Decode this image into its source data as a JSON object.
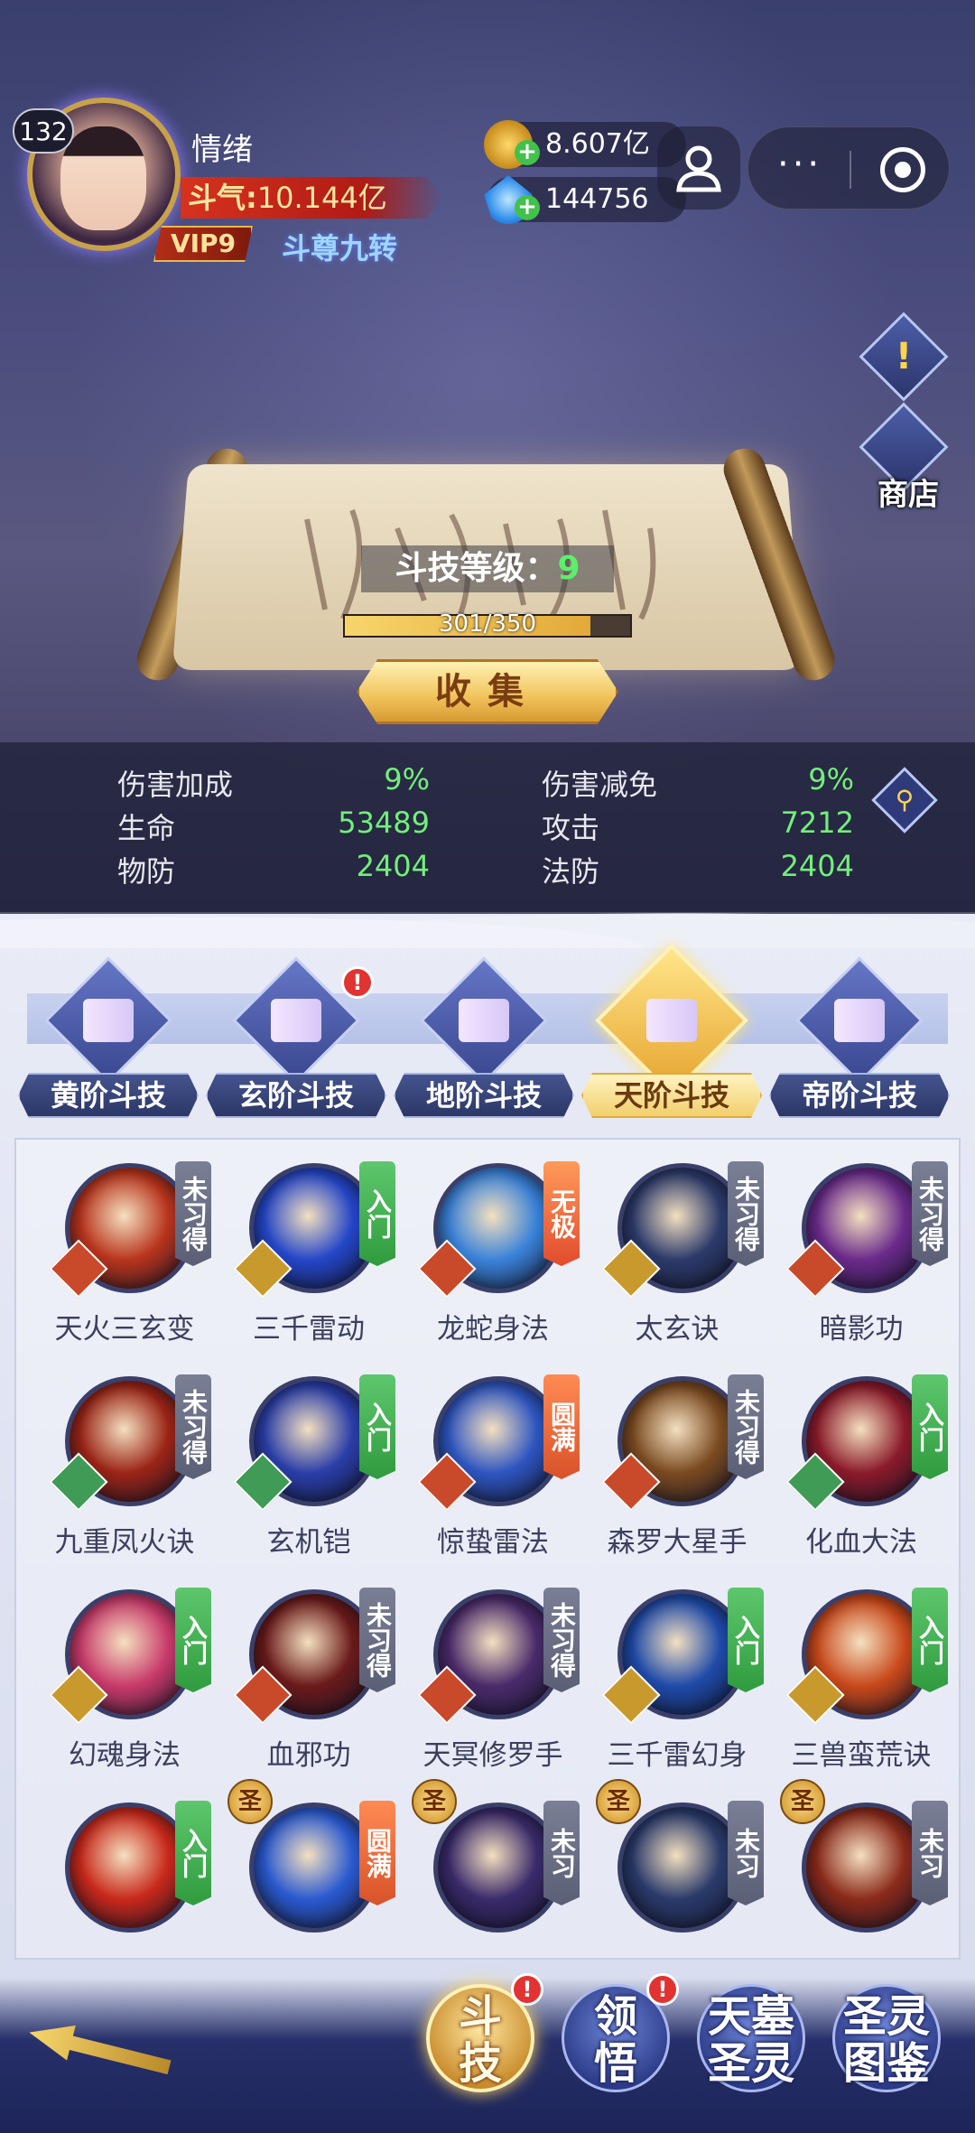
{
  "player": {
    "level": "132",
    "name": "情绪",
    "power_label": "斗气:",
    "power_value": "10.144亿",
    "vip": "VIP9",
    "rank": "斗尊九转"
  },
  "currency": {
    "coins": "8.607亿",
    "gems": "144756"
  },
  "capsule": {
    "more": "···"
  },
  "side": {
    "alert": "!",
    "shop": "商店"
  },
  "scroll": {
    "skill_level_label": "斗技等级：",
    "skill_level": "9",
    "exp_text": "301/350",
    "exp_progress": 0.86,
    "collect": "收集"
  },
  "stats": [
    {
      "key": "伤害加成",
      "value": "9%"
    },
    {
      "key": "伤害减免",
      "value": "9%"
    },
    {
      "key": "生命",
      "value": "53489"
    },
    {
      "key": "攻击",
      "value": "7212"
    },
    {
      "key": "物防",
      "value": "2404"
    },
    {
      "key": "法防",
      "value": "2404"
    }
  ],
  "tabs": [
    {
      "label": "黄阶斗技",
      "active": false,
      "alert": ""
    },
    {
      "label": "玄阶斗技",
      "active": false,
      "alert": "!"
    },
    {
      "label": "地阶斗技",
      "active": false,
      "alert": ""
    },
    {
      "label": "天阶斗技",
      "active": true,
      "alert": ""
    },
    {
      "label": "帝阶斗技",
      "active": false,
      "alert": ""
    }
  ],
  "skills": [
    {
      "name": "天火三玄变",
      "tag": "未习得",
      "tag_type": "none",
      "elem": "fire",
      "color": "#b8341c"
    },
    {
      "name": "三千雷动",
      "tag": "入门",
      "tag_type": "entry",
      "elem": "gold",
      "color": "#2446c8"
    },
    {
      "name": "龙蛇身法",
      "tag": "无极",
      "tag_type": "ultimate",
      "elem": "fire",
      "color": "#3a82d8"
    },
    {
      "name": "太玄诀",
      "tag": "未习得",
      "tag_type": "none",
      "elem": "gold",
      "color": "#2c3a6a"
    },
    {
      "name": "暗影功",
      "tag": "未习得",
      "tag_type": "none",
      "elem": "fire",
      "color": "#6a2a8a"
    },
    {
      "name": "九重凤火诀",
      "tag": "未习得",
      "tag_type": "none",
      "elem": "wood",
      "color": "#9a2416"
    },
    {
      "name": "玄机铠",
      "tag": "入门",
      "tag_type": "entry",
      "elem": "wood",
      "color": "#2a3ea8"
    },
    {
      "name": "惊蛰雷法",
      "tag": "圆满",
      "tag_type": "perfect",
      "elem": "fire",
      "color": "#2e55c0"
    },
    {
      "name": "森罗大星手",
      "tag": "未习得",
      "tag_type": "none",
      "elem": "fire",
      "color": "#7a4a20"
    },
    {
      "name": "化血大法",
      "tag": "入门",
      "tag_type": "entry",
      "elem": "wood",
      "color": "#8a1a2a"
    },
    {
      "name": "幻魂身法",
      "tag": "入门",
      "tag_type": "entry",
      "elem": "gold",
      "color": "#c83a6a"
    },
    {
      "name": "血邪功",
      "tag": "未习得",
      "tag_type": "none",
      "elem": "fire",
      "color": "#6a1a1a"
    },
    {
      "name": "天冥修罗手",
      "tag": "未习得",
      "tag_type": "none",
      "elem": "fire",
      "color": "#4a2a6a"
    },
    {
      "name": "三千雷幻身",
      "tag": "入门",
      "tag_type": "entry",
      "elem": "gold",
      "color": "#1e4aa8"
    },
    {
      "name": "三兽蛮荒诀",
      "tag": "入门",
      "tag_type": "entry",
      "elem": "gold",
      "color": "#c8481a"
    }
  ],
  "partial_row": [
    {
      "tag": "入门",
      "tag_type": "entry",
      "saint": "",
      "color": "#c8281a"
    },
    {
      "tag": "圆满",
      "tag_type": "perfect",
      "saint": "圣",
      "color": "#2a5ad0"
    },
    {
      "tag": "未习",
      "tag_type": "none",
      "saint": "圣",
      "color": "#3a2a6a"
    },
    {
      "tag": "未习",
      "tag_type": "none",
      "saint": "圣",
      "color": "#2a3a6a"
    },
    {
      "tag": "未习",
      "tag_type": "none",
      "saint": "圣",
      "color": "#8a2a1a"
    }
  ],
  "nav": [
    {
      "label": "斗技",
      "active": true,
      "alert": "!"
    },
    {
      "label": "领悟",
      "active": false,
      "alert": "!"
    },
    {
      "label": "天墓圣灵",
      "active": false,
      "alert": ""
    },
    {
      "label": "圣灵图鉴",
      "active": false,
      "alert": ""
    }
  ]
}
